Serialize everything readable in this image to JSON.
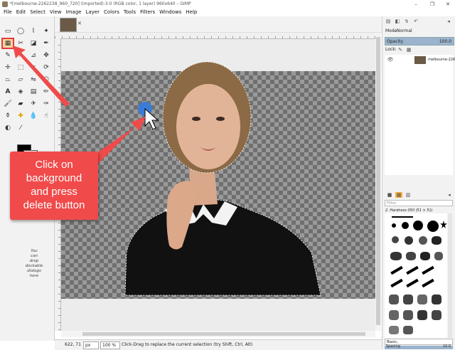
{
  "window": {
    "title": "*[melbourne-2262238_960_720] (imported)-3.0 (RGB color, 1 layer) 960x640 – GIMP",
    "minimize": "–",
    "maximize": "❐",
    "close": "✕"
  },
  "menu": [
    "File",
    "Edit",
    "Select",
    "View",
    "Image",
    "Layer",
    "Colors",
    "Tools",
    "Filters",
    "Windows",
    "Help"
  ],
  "toolbox": {
    "dock_hint": "You\ncan\ndrop\ndockable\ndialogs\nhere"
  },
  "image_tab": {
    "close": "✕"
  },
  "statusbar": {
    "coords": "622, 71",
    "unit": "px",
    "zoom": "100 %",
    "message": "Click-Drag to replace the current selection (try Shift, Ctrl, Alt)"
  },
  "layers_panel": {
    "mode_label": "Mode",
    "mode_value": "Normal",
    "opacity_label": "Opacity",
    "opacity_value": "100.0",
    "lock_label": "Lock:",
    "layer_name": "melbourne-22622"
  },
  "brushes_panel": {
    "filter_placeholder": "Filter",
    "brush_name": "2. Hardness 050 (51 × 51)",
    "preset": "Basic,",
    "spacing_label": "Spacing",
    "spacing_value": "10.0"
  },
  "annotation": {
    "text": "Click on\nbackground\nand press\ndelete button",
    "color": "#f04a4a"
  },
  "colors": {
    "foreground": "#000000",
    "background": "#ffffff"
  }
}
